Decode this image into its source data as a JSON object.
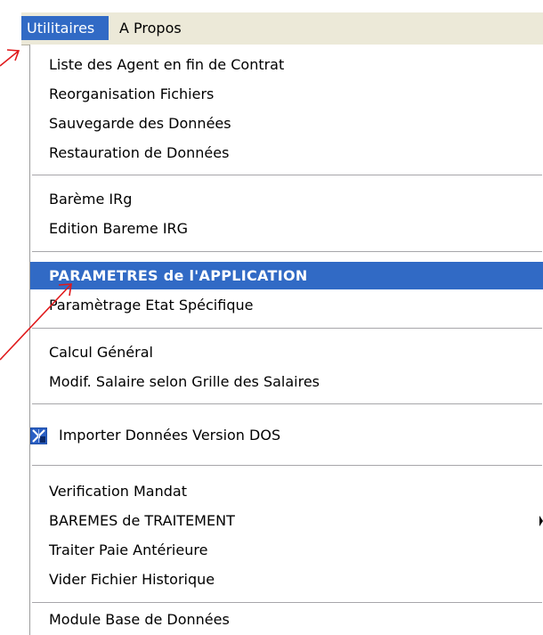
{
  "menubar": {
    "items": [
      {
        "label": "Utilitaires",
        "active": true
      },
      {
        "label": "A Propos",
        "active": false
      }
    ]
  },
  "dropdown": {
    "groups": [
      [
        {
          "label": "Liste des Agent en fin de Contrat"
        },
        {
          "label": "Reorganisation Fichiers"
        },
        {
          "label": "Sauvegarde des Données"
        },
        {
          "label": "Restauration  de Données"
        }
      ],
      [
        {
          "label": "Barème IRg"
        },
        {
          "label": "Edition Bareme IRG"
        }
      ],
      [
        {
          "label": "PARAMETRES de l'APPLICATION",
          "highlighted": true
        },
        {
          "label": "Paramètrage Etat Spécifique"
        }
      ],
      [
        {
          "label": "Calcul Général"
        },
        {
          "label": "Modif. Salaire selon Grille des Salaires"
        }
      ],
      [
        {
          "label": "Importer Données Version DOS",
          "icon": "dos-import-icon"
        }
      ],
      [
        {
          "label": "Verification  Mandat"
        },
        {
          "label": "BAREMES de TRAITEMENT",
          "has_submenu": true
        },
        {
          "label": "Traiter Paie Antérieure"
        },
        {
          "label": "Vider Fichier Historique"
        }
      ],
      [
        {
          "label": "Module Base de Données"
        }
      ]
    ]
  },
  "colors": {
    "highlight": "#316ac5",
    "menubar_bg": "#ece9d8",
    "annotation_arrow": "#e0191b"
  }
}
